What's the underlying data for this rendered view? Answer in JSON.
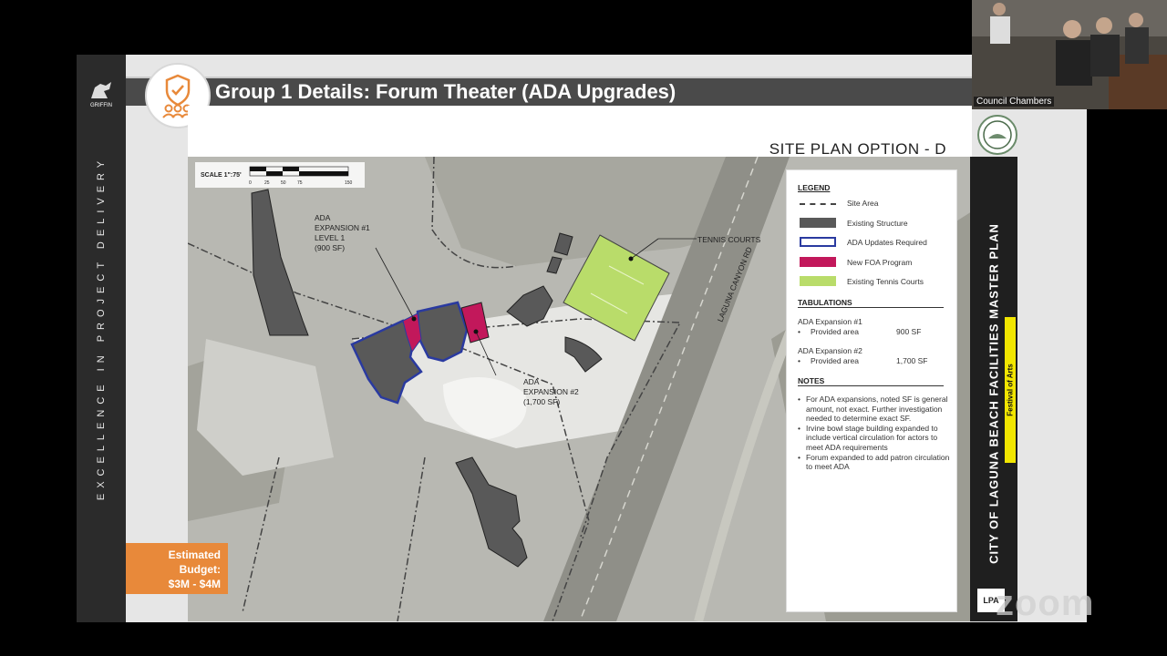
{
  "slide": {
    "title": "Group 1 Details: Forum Theater (ADA Upgrades)",
    "vertical_tagline": "EXCELLENCE IN PROJECT DELIVERY",
    "logo_text": "GRIFFIN",
    "budget_label": "Estimated Budget:",
    "budget_value": "$3M - $4M",
    "site_plan_title": "SITE PLAN OPTION -  D",
    "scale_label": "SCALE 1\":75'",
    "scale_ticks": [
      "0",
      "25",
      "50",
      "75",
      "150"
    ],
    "right_title": "CITY OF LAGUNA BEACH FACILITIES MASTER PLAN",
    "right_subtitle": "Festival of Arts",
    "lpa_label": "LPA",
    "map_labels": {
      "exp1": [
        "ADA",
        "EXPANSION #1",
        "LEVEL 1",
        "(900 SF)"
      ],
      "exp2": [
        "ADA",
        "EXPANSION #2",
        "(1,700 SF)"
      ],
      "tennis": "TENNIS COURTS",
      "road": "LAGUNA CANYON RD"
    },
    "legend": {
      "heading": "LEGEND",
      "items": [
        {
          "label": "Site Area"
        },
        {
          "label": "Existing Structure",
          "color": "#595959"
        },
        {
          "label": "ADA Updates Required",
          "color": "#2a3aa0"
        },
        {
          "label": "New FOA Program",
          "color": "#c2185b"
        },
        {
          "label": "Existing Tennis Courts",
          "color": "#b9dc6a"
        }
      ],
      "tabulations_heading": "TABULATIONS",
      "tab1_title": "ADA Expansion #1",
      "tab1_label": "Provided area",
      "tab1_value": "900 SF",
      "tab2_title": "ADA Expansion #2",
      "tab2_label": "Provided area",
      "tab2_value": "1,700 SF",
      "notes_heading": "NOTES",
      "notes": [
        "For ADA expansions, noted SF is general amount, not exact. Further investigation needed to determine exact SF.",
        "Irvine bowl stage building expanded to include vertical circulation for actors to meet ADA requirements",
        "Forum expanded to add patron circulation to meet ADA"
      ]
    }
  },
  "video": {
    "participant_label": "Council Chambers",
    "watermark": "zoom"
  }
}
